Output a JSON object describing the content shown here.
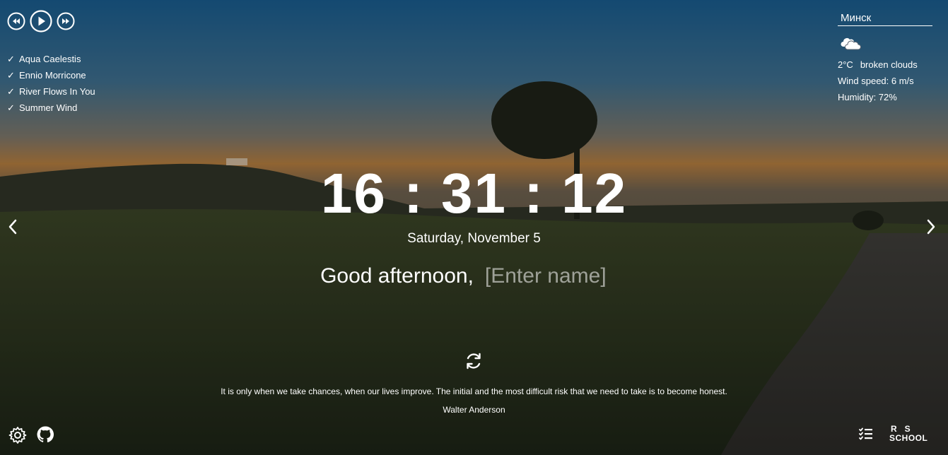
{
  "player": {
    "controls": {
      "prev": "rewind-icon",
      "play": "play-icon",
      "next": "fast-forward-icon"
    },
    "playlist": [
      {
        "check": "✓",
        "title": "Aqua Caelestis"
      },
      {
        "check": "✓",
        "title": "Ennio Morricone"
      },
      {
        "check": "✓",
        "title": "River Flows In You"
      },
      {
        "check": "✓",
        "title": "Summer Wind"
      }
    ]
  },
  "weather": {
    "city": "Минск",
    "icon": "cloudy-icon",
    "temperature": "2°C",
    "description": "broken clouds",
    "wind": "Wind speed: 6 m/s",
    "humidity": "Humidity: 72%"
  },
  "clock": {
    "time": "16 : 31 : 12",
    "date": "Saturday, November 5"
  },
  "greeting": {
    "text": "Good afternoon,",
    "name_placeholder": "[Enter name]"
  },
  "quote": {
    "text": "It is only when we take chances, when our lives improve. The initial and the most difficult risk that we need to take is to become honest.",
    "author": "Walter Anderson"
  },
  "footer": {
    "rs_logo_top": "RS",
    "rs_logo_bottom": "SCHOOL"
  },
  "colors": {
    "text": "#ffffff",
    "placeholder": "#9a9a9a"
  }
}
